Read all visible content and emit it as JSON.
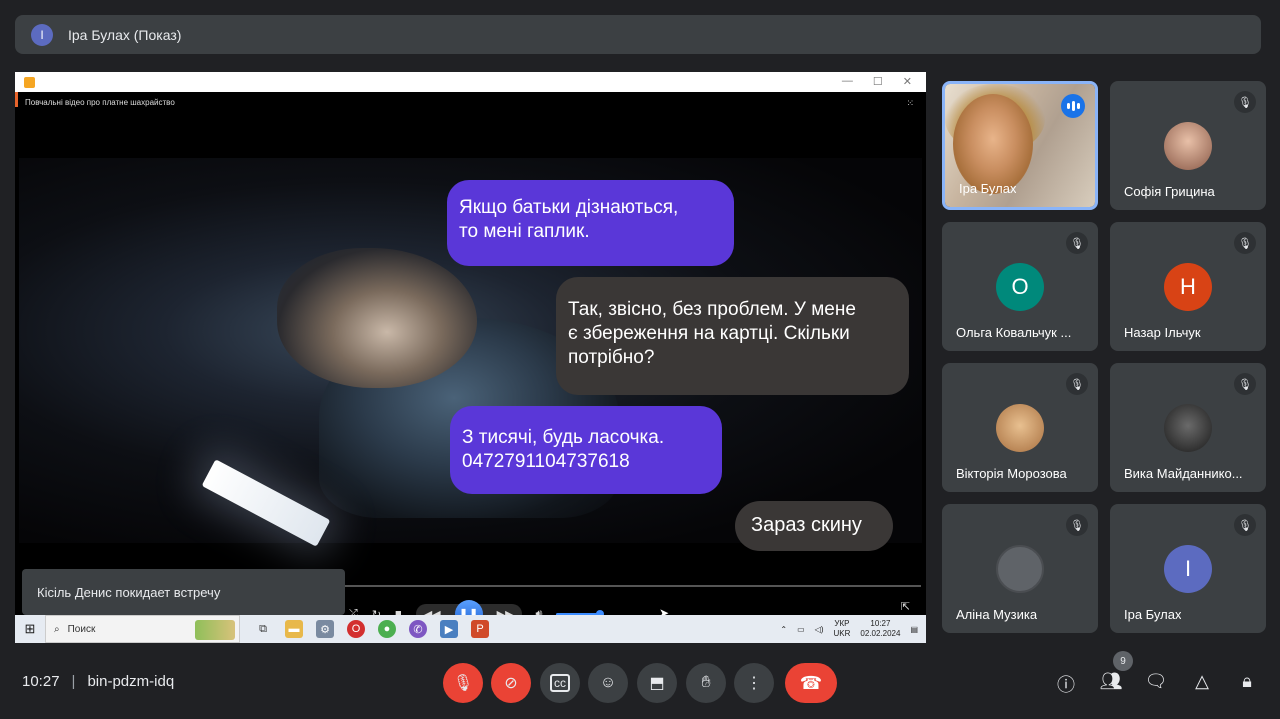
{
  "header": {
    "avatar_initial": "І",
    "title": "Іра Булах (Показ)"
  },
  "presentation": {
    "video_title": "Повчальні відео про платне шахрайство",
    "bubbles": [
      "Якщо батьки дізнаються,\nто мені гаплик.",
      "Так, звісно, без проблем. У мене\nє збереження на картці. Скільки\nпотрібно?",
      "З тисячі, будь ласочка.\n0472791104737618",
      "Зараз скину"
    ],
    "progress": 0.035,
    "toast": "Кісіль Денис покидает встречу",
    "taskbar": {
      "search_placeholder": "Поиск",
      "lang_top": "УКР",
      "lang_bottom": "UKR",
      "time": "10:27",
      "date": "02.02.2024"
    }
  },
  "participants": [
    {
      "name": "Іра Булах",
      "type": "camera",
      "speaking": true
    },
    {
      "name": "Софія Грицина",
      "type": "photo",
      "color": "#c98a70",
      "muted": true
    },
    {
      "name": "Ольга Ковальчук ...",
      "initial": "О",
      "color": "#00897b",
      "muted": true
    },
    {
      "name": "Назар Ільчук",
      "initial": "Н",
      "color": "#d84315",
      "muted": true
    },
    {
      "name": "Вікторія Морозова",
      "type": "photo",
      "color": "#b08060",
      "muted": true
    },
    {
      "name": "Вика Майданнико...",
      "type": "photo",
      "color": "#2a2a2a",
      "muted": true
    },
    {
      "name": "Аліна Музика",
      "type": "photo",
      "color": "#5f6368",
      "muted": true
    },
    {
      "name": "Іра Булах",
      "initial": "І",
      "color": "#5c6bc0",
      "muted": true
    }
  ],
  "bottom": {
    "time": "10:27",
    "meeting_code": "bin-pdzm-idq",
    "people_count": "9"
  },
  "colors": {
    "accent": "#8ab4f8",
    "danger": "#ea4335",
    "bubble_purple": "#5a37d8",
    "bubble_gray": "#3a3736"
  }
}
